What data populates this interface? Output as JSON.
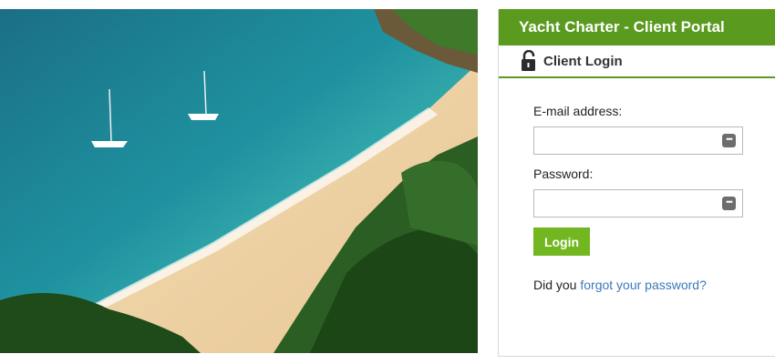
{
  "hero": {
    "icon": "beach-photo"
  },
  "panel": {
    "title": "Yacht Charter - Client Portal",
    "subtitle": "Client Login",
    "lock_icon": "lock-icon",
    "accent_color": "#5a9a1e",
    "button_color": "#72b620"
  },
  "form": {
    "email_label": "E-mail address:",
    "email_value": "",
    "email_placeholder": "",
    "password_label": "Password:",
    "password_value": "",
    "password_placeholder": "",
    "password_icon": "password-manager-icon",
    "login_label": "Login"
  },
  "forgot": {
    "prefix": "Did you",
    "link_text": "forgot your password?"
  }
}
